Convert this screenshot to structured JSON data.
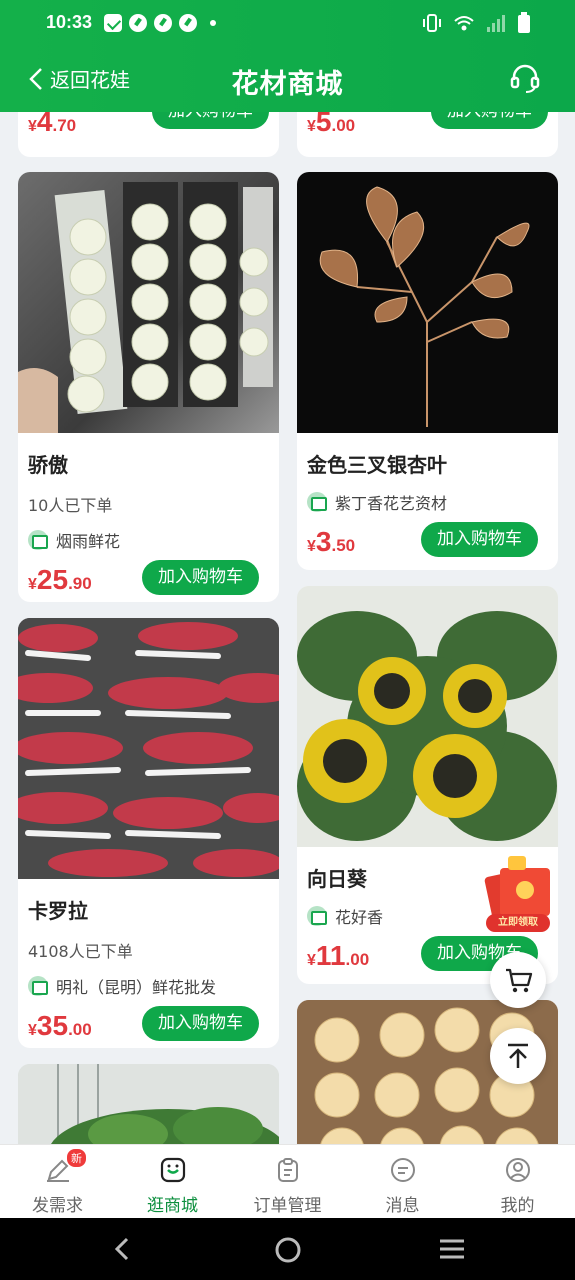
{
  "status_bar": {
    "time": "10:33"
  },
  "header": {
    "back_label": "返回花娃",
    "title": "花材商城"
  },
  "colors": {
    "brand_green": "#0fa84a",
    "price_red": "#e0393e"
  },
  "partial_top": [
    {
      "price_int": "4",
      "price_dec": ".70",
      "button": "加入购物车"
    },
    {
      "price_int": "5",
      "price_dec": ".00",
      "button": "加入购物车"
    }
  ],
  "products": [
    {
      "name": "骄傲",
      "orders": "10人已下单",
      "shop": "烟雨鲜花",
      "currency": "¥",
      "price_int": "25",
      "price_dec": ".90",
      "button": "加入购物车"
    },
    {
      "name": "金色三叉银杏叶",
      "shop": "紫丁香花艺资材",
      "currency": "¥",
      "price_int": "3",
      "price_dec": ".50",
      "button": "加入购物车"
    },
    {
      "name": "卡罗拉",
      "orders": "4108人已下单",
      "shop": "明礼（昆明）鲜花批发",
      "currency": "¥",
      "price_int": "35",
      "price_dec": ".00",
      "button": "加入购物车"
    },
    {
      "name": "向日葵",
      "shop": "花好香",
      "currency": "¥",
      "price_int": "11",
      "price_dec": ".00",
      "button": "加入购物车"
    }
  ],
  "promo": {
    "line1": "一元门槛",
    "line2": "立即领取"
  },
  "tabs": [
    {
      "label": "发需求",
      "badge": "新",
      "icon": "edit-icon"
    },
    {
      "label": "逛商城",
      "icon": "shop-icon",
      "active": true
    },
    {
      "label": "订单管理",
      "icon": "clipboard-icon"
    },
    {
      "label": "消息",
      "icon": "message-icon"
    },
    {
      "label": "我的",
      "icon": "user-icon"
    }
  ]
}
